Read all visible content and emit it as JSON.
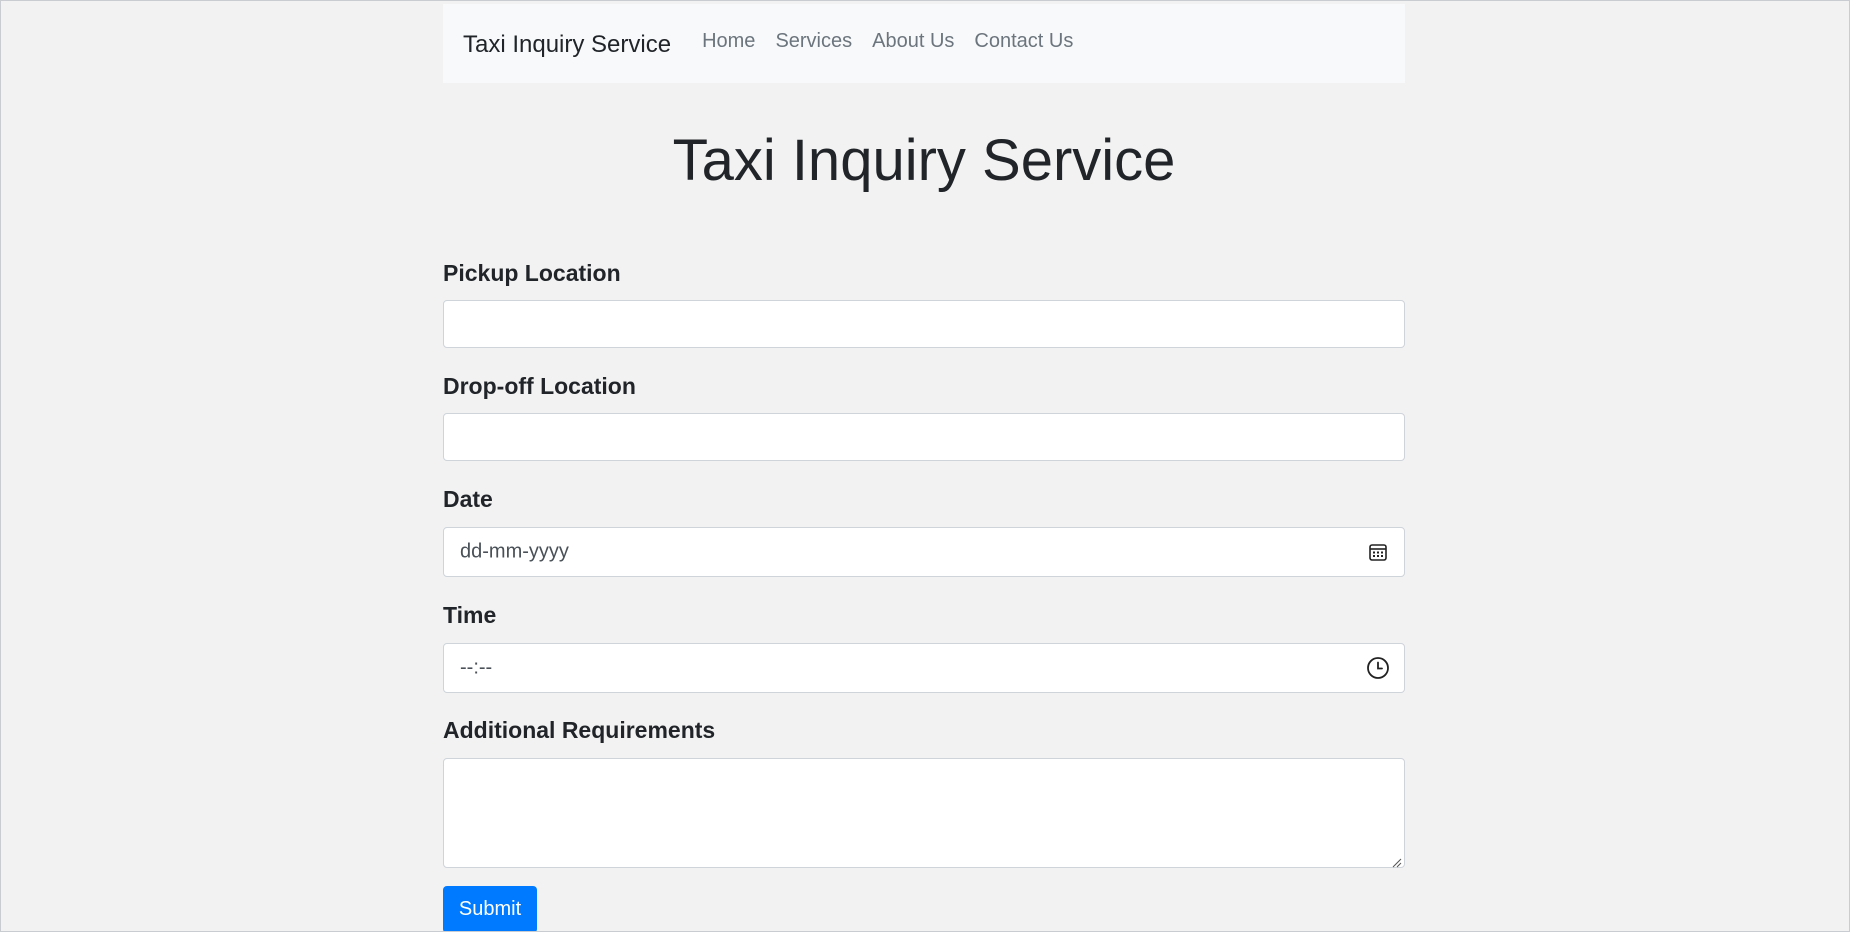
{
  "navbar": {
    "brand": "Taxi Inquiry Service",
    "links": [
      "Home",
      "Services",
      "About Us",
      "Contact Us"
    ]
  },
  "page": {
    "title": "Taxi Inquiry Service"
  },
  "form": {
    "pickup_label": "Pickup Location",
    "pickup_value": "",
    "dropoff_label": "Drop-off Location",
    "dropoff_value": "",
    "date_label": "Date",
    "date_placeholder": "dd-mm-yyyy",
    "date_icon": "calendar-icon",
    "time_label": "Time",
    "time_placeholder": "--:--",
    "time_icon": "clock-icon",
    "requirements_label": "Additional Requirements",
    "requirements_value": "",
    "submit_label": "Submit"
  },
  "colors": {
    "primary": "#007bff",
    "background": "#f2f2f2",
    "navbar_bg": "#f8f9fa",
    "nav_link": "#6c757d",
    "text": "#212529"
  }
}
